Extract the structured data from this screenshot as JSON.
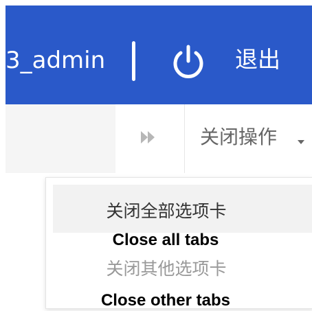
{
  "header": {
    "username": "3_admin",
    "logout_label": "退出",
    "icon": "power-icon",
    "background_color": "#2a59c9"
  },
  "tabbar": {
    "scroll_next_icon": "double-chevron-right-icon",
    "close_operations_label": "关闭操作",
    "caret_icon": "caret-down-icon"
  },
  "dropdown": {
    "items": [
      {
        "label": "关闭全部选项卡",
        "annotation": "Close all tabs",
        "hovered": true
      },
      {
        "label": "关闭其他选项卡",
        "annotation": "Close other tabs",
        "hovered": false
      }
    ]
  }
}
